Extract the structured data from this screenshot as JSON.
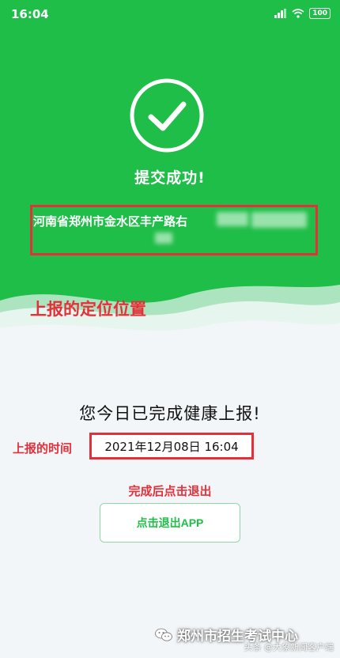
{
  "status_bar": {
    "time": "16:04",
    "battery": "100"
  },
  "success": {
    "title": "提交成功!"
  },
  "address": {
    "text": "河南省郑州市金水区丰产路右"
  },
  "annotations": {
    "location": "上报的定位位置",
    "time": "上报的时间",
    "exit_hint": "完成后点击退出"
  },
  "report": {
    "done_title": "您今日已完成健康上报!",
    "timestamp": "2021年12月08日 16:04"
  },
  "exit_button": {
    "label": "点击退出APP"
  },
  "watermark": {
    "main": "郑州市招生考试中心",
    "sub": "头条 @大象新闻客户端"
  },
  "colors": {
    "brand_green": "#1fbe48",
    "annotation_red": "#e5303a"
  }
}
